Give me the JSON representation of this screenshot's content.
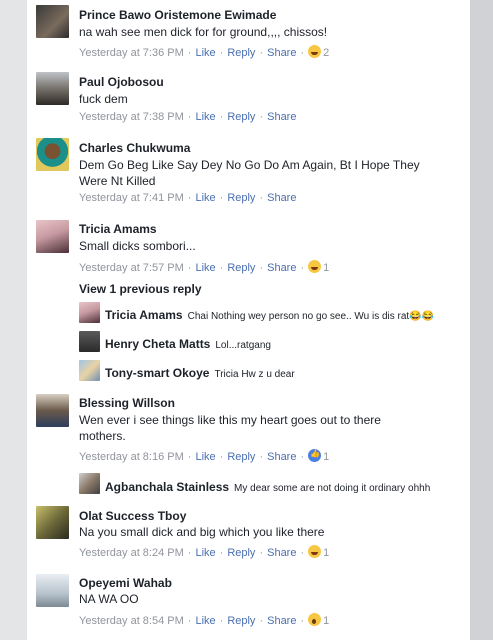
{
  "comments": [
    {
      "name": "Prince Bawo Oristemone Ewimade",
      "text": [
        "na wah see men dick for for ground,,,, chissos!"
      ],
      "time": "Yesterday at 7:36 PM",
      "like": "Like",
      "reply": "Reply",
      "share": "Share",
      "reaction": "haha",
      "count": "2"
    },
    {
      "name": "Paul Ojobosou",
      "text": [
        "fuck dem"
      ],
      "time": "Yesterday at 7:38 PM",
      "like": "Like",
      "reply": "Reply",
      "share": "Share"
    },
    {
      "name": "Charles Chukwuma",
      "text": [
        "Dem Go Beg Like Say Dey No Go Do Am Again, Bt I Hope They",
        "Were Nt Killed"
      ],
      "time": "Yesterday at 7:41 PM",
      "like": "Like",
      "reply": "Reply",
      "share": "Share"
    },
    {
      "name": "Tricia Amams",
      "text": [
        "Small dicks sombori..."
      ],
      "time": "Yesterday at 7:57 PM",
      "like": "Like",
      "reply": "Reply",
      "share": "Share",
      "reaction": "haha",
      "count": "1"
    },
    {
      "name": "Blessing Willson",
      "text": [
        "Wen ever i see things like this my heart goes out to there",
        "mothers."
      ],
      "time": "Yesterday at 8:16 PM",
      "like": "Like",
      "reply": "Reply",
      "share": "Share",
      "reaction": "like",
      "count": "1"
    },
    {
      "name": "Olat Success Tboy",
      "text": [
        "Na you small dick and big which you like there"
      ],
      "time": "Yesterday at 8:24 PM",
      "like": "Like",
      "reply": "Reply",
      "share": "Share",
      "reaction": "haha",
      "count": "1"
    },
    {
      "name": "Opeyemi Wahab",
      "text": [
        "NA WA OO"
      ],
      "time": "Yesterday at 8:54 PM",
      "like": "Like",
      "reply": "Reply",
      "share": "Share",
      "reaction": "wow",
      "count": "1"
    }
  ],
  "view_previous": "View 1 previous reply",
  "replies_tricia": [
    {
      "name": "Tricia Amams",
      "text": "Chai Nothing wey person no go see.. Wu is dis rat😂😂"
    },
    {
      "name": "Henry Cheta Matts",
      "text": "Lol...ratgang"
    },
    {
      "name": "Tony-smart Okoye",
      "text": "Tricia Hw z u dear"
    }
  ],
  "replies_blessing": [
    {
      "name": "Agbanchala Stainless",
      "text": "My dear some are not doing it ordinary ohhh"
    }
  ]
}
